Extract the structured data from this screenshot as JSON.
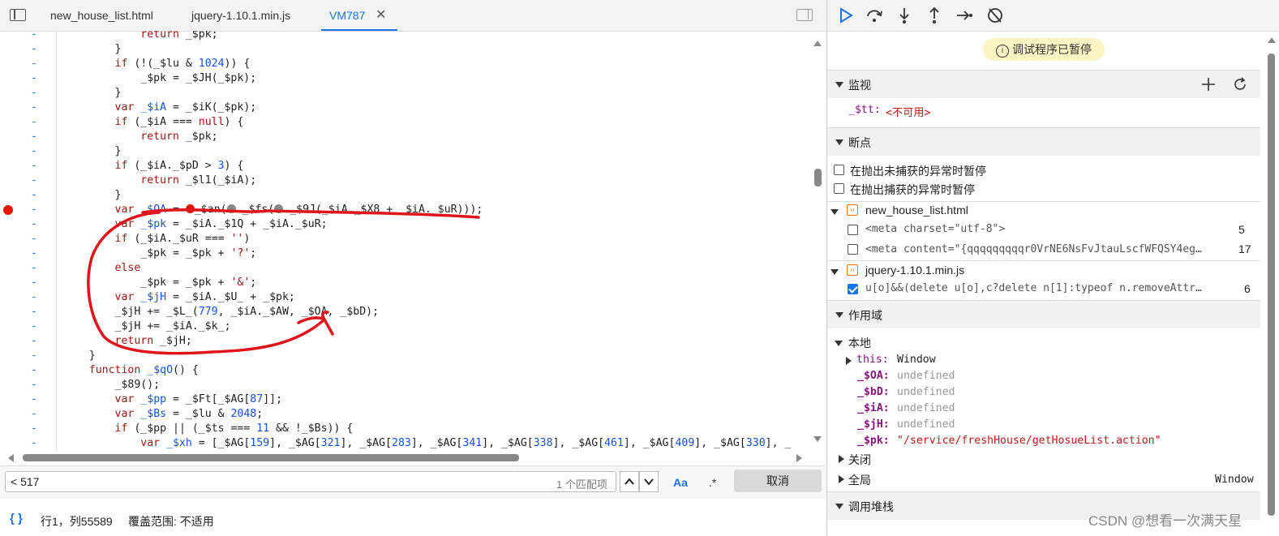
{
  "tabs": [
    {
      "label": "new_house_list.html",
      "active": false
    },
    {
      "label": "jquery-1.10.1.min.js",
      "active": false
    },
    {
      "label": "VM787",
      "active": true
    }
  ],
  "code_lines": [
    {
      "gutter": "-",
      "html": "            <span class='k'>return</span> _$pk;",
      "bp": false
    },
    {
      "gutter": "-",
      "html": "        }",
      "bp": false
    },
    {
      "gutter": "-",
      "html": "        <span class='k'>if</span> (!(_$lu &amp; <span class='n'>1024</span>)) {",
      "bp": false
    },
    {
      "gutter": "-",
      "html": "            _$pk = _$JH(_$pk);",
      "bp": false
    },
    {
      "gutter": "-",
      "html": "        }",
      "bp": false
    },
    {
      "gutter": "-",
      "html": "        <span class='k'>var</span> <span class='v'>_$iA</span> = _$iK(_$pk);",
      "bp": false
    },
    {
      "gutter": "-",
      "html": "        <span class='k'>if</span> (_$iA === <span class='k'>null</span>) {",
      "bp": false
    },
    {
      "gutter": "-",
      "html": "            <span class='k'>return</span> _$pk;",
      "bp": false
    },
    {
      "gutter": "-",
      "html": "        }",
      "bp": false
    },
    {
      "gutter": "-",
      "html": "        <span class='k'>if</span> (_$iA._$pD &gt; <span class='n'>3</span>) {",
      "bp": false
    },
    {
      "gutter": "-",
      "html": "            <span class='k'>return</span> _$l1(_$iA);",
      "bp": false
    },
    {
      "gutter": "-",
      "html": "        }",
      "bp": false
    },
    {
      "gutter": "-",
      "html": "        <span class='k'>var</span> <span class='v'>_$OA</span> = <span class='inline-dot'></span>_$an(<span class='inline-grey'></span> _$fs(<span class='inline-grey'></span> _$9J(_$iA._$X8 + _$iA._$uR)));",
      "bp": true
    },
    {
      "gutter": "-",
      "html": "        <span class='k'>var</span> <span class='v'>_$pk</span> = _$iA._$1Q + _$iA._$uR;",
      "bp": false
    },
    {
      "gutter": "-",
      "html": "        <span class='k'>if</span> (_$iA._$uR === <span class='s'>''</span>)",
      "bp": false
    },
    {
      "gutter": "-",
      "html": "            _$pk = _$pk + <span class='s'>'?'</span>;",
      "bp": false
    },
    {
      "gutter": "-",
      "html": "        <span class='k'>else</span>",
      "bp": false
    },
    {
      "gutter": "-",
      "html": "            _$pk = _$pk + <span class='s'>'&amp;'</span>;",
      "bp": false
    },
    {
      "gutter": "-",
      "html": "        <span class='k'>var</span> <span class='v'>_$jH</span> = _$iA._$U_ + _$pk;",
      "bp": false
    },
    {
      "gutter": "-",
      "html": "        _$jH += _$L_(<span class='n'>779</span>, _$iA._$AW, _$OA, _$bD);",
      "bp": false
    },
    {
      "gutter": "-",
      "html": "        _$jH += _$iA._$k_;",
      "bp": false
    },
    {
      "gutter": "-",
      "html": "        <span class='k'>return</span> _$jH;",
      "bp": false
    },
    {
      "gutter": "-",
      "html": "    }",
      "bp": false
    },
    {
      "gutter": "-",
      "html": "    <span class='k'>function</span> <span class='fn'>_$qO</span>() {",
      "bp": false
    },
    {
      "gutter": "-",
      "html": "        _$89();",
      "bp": false
    },
    {
      "gutter": "-",
      "html": "        <span class='k'>var</span> <span class='v'>_$pp</span> = _$Ft[_$AG[<span class='n'>87</span>]];",
      "bp": false
    },
    {
      "gutter": "-",
      "html": "        <span class='k'>var</span> <span class='v'>_$Bs</span> = _$lu &amp; <span class='n'>2048</span>;",
      "bp": false
    },
    {
      "gutter": "-",
      "html": "        <span class='k'>if</span> (_$pp || (_$ts === <span class='n'>11</span> &amp;&amp; !_$Bs)) {",
      "bp": false
    },
    {
      "gutter": "-",
      "html": "            <span class='k'>var</span> <span class='v'>_$xh</span> = [_$AG[<span class='n'>159</span>], _$AG[<span class='n'>321</span>], _$AG[<span class='n'>283</span>], _$AG[<span class='n'>341</span>], _$AG[<span class='n'>338</span>], _$AG[<span class='n'>461</span>], _$AG[<span class='n'>409</span>], _$AG[<span class='n'>330</span>], _",
      "bp": false
    }
  ],
  "search": {
    "value": "< 517",
    "count": "1 个匹配项",
    "case_label": "Aa",
    "regex_label": ".*",
    "cancel_label": "取消"
  },
  "status": {
    "pretty": "{ }",
    "position": "行1，列55589",
    "coverage": "覆盖范围: 不适用"
  },
  "debugger": {
    "paused": "调试程序已暂停",
    "watch_title": "监视",
    "watch_expr": "_$tt:",
    "watch_val": "<不可用>",
    "breakpoints_title": "断点",
    "pause_uncaught": "在抛出未捕获的异常时暂停",
    "pause_caught": "在抛出捕获的异常时暂停",
    "files": [
      {
        "name": "new_house_list.html",
        "items": [
          {
            "code": "<meta charset=\"utf-8\">",
            "line": "5",
            "checked": false
          },
          {
            "code": "<meta content=\"{qqqqqqqqqr0VrNE6NsFvJtauLscfWFQSY4eg…",
            "line": "17",
            "checked": false
          }
        ]
      },
      {
        "name": "jquery-1.10.1.min.js",
        "items": [
          {
            "code": "u[o]&&(delete u[o],c?delete n[1]:typeof n.removeAttr…",
            "line": "6",
            "checked": true
          }
        ]
      }
    ],
    "scope_title": "作用域",
    "local_label": "本地",
    "scope_vars": [
      {
        "name": "this:",
        "value": "Window",
        "type": "win",
        "expandable": true
      },
      {
        "name": "_$OA:",
        "value": "undefined",
        "type": "undef"
      },
      {
        "name": "_$bD:",
        "value": "undefined",
        "type": "undef"
      },
      {
        "name": "_$iA:",
        "value": "undefined",
        "type": "undef"
      },
      {
        "name": "_$jH:",
        "value": "undefined",
        "type": "undef"
      },
      {
        "name": "_$pk:",
        "value": "\"/service/freshHouse/getHosueList.action\"",
        "type": "str"
      }
    ],
    "closure_label": "关闭",
    "global_label": "全局",
    "global_value": "Window",
    "callstack_title": "调用堆栈"
  },
  "watermark": "CSDN @想看一次满天星"
}
